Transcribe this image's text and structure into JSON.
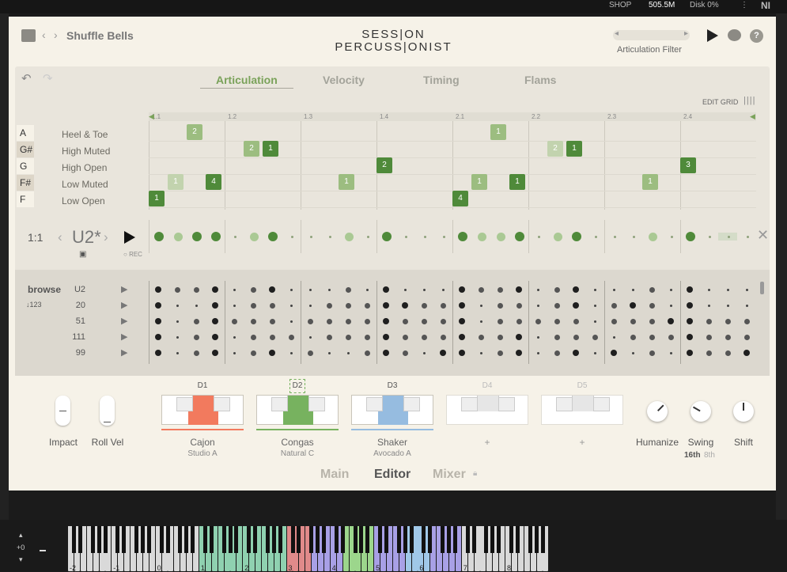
{
  "topbar": {
    "shop": "SHOP",
    "memory": "505.5M",
    "disk": "Disk 0%",
    "ni_logo": "NI"
  },
  "header": {
    "preset_name": "Shuffle Bells",
    "logo_line1": "SESS|ON",
    "logo_line2": "PERCUSS|ONIST",
    "articulation_filter": "Articulation Filter"
  },
  "tabs": [
    "Articulation",
    "Velocity",
    "Timing",
    "Flams"
  ],
  "active_tab": "Articulation",
  "edit_grid": "EDIT GRID",
  "ruler_ticks": [
    "1.1",
    "1.2",
    "1.3",
    "1.4",
    "2.1",
    "2.2",
    "2.3",
    "2.4"
  ],
  "rows": [
    {
      "note": "A",
      "label": "Heel & Toe"
    },
    {
      "note": "G#",
      "label": "High Muted"
    },
    {
      "note": "G",
      "label": "High Open"
    },
    {
      "note": "F#",
      "label": "Low Muted"
    },
    {
      "note": "F",
      "label": "Low Open"
    }
  ],
  "notes": [
    {
      "row": 0,
      "step": 2,
      "value": "2",
      "shade": 2
    },
    {
      "row": 0,
      "step": 18,
      "value": "1",
      "shade": 2
    },
    {
      "row": 1,
      "step": 5,
      "value": "2",
      "shade": 2
    },
    {
      "row": 1,
      "step": 6,
      "value": "1",
      "shade": 3
    },
    {
      "row": 1,
      "step": 21,
      "value": "2",
      "shade": 1
    },
    {
      "row": 1,
      "step": 22,
      "value": "1",
      "shade": 3
    },
    {
      "row": 2,
      "step": 12,
      "value": "2",
      "shade": 3
    },
    {
      "row": 2,
      "step": 28,
      "value": "3",
      "shade": 3
    },
    {
      "row": 3,
      "step": 1,
      "value": "1",
      "shade": 1
    },
    {
      "row": 3,
      "step": 3,
      "value": "4",
      "shade": 3
    },
    {
      "row": 3,
      "step": 10,
      "value": "1",
      "shade": 2
    },
    {
      "row": 3,
      "step": 17,
      "value": "1",
      "shade": 2
    },
    {
      "row": 3,
      "step": 19,
      "value": "1",
      "shade": 3
    },
    {
      "row": 3,
      "step": 26,
      "value": "1",
      "shade": 2
    },
    {
      "row": 4,
      "step": 0,
      "value": "1",
      "shade": 3
    },
    {
      "row": 4,
      "step": 16,
      "value": "4",
      "shade": 3
    }
  ],
  "pattern": {
    "ratio": "1:1",
    "name": "U2*",
    "rec": "REC"
  },
  "pattern_dots": [
    3,
    2,
    3,
    3,
    0,
    2,
    3,
    0,
    0,
    0,
    2,
    0,
    3,
    0,
    0,
    0,
    3,
    2,
    2,
    3,
    0,
    2,
    3,
    0,
    0,
    0,
    2,
    0,
    3,
    0,
    0,
    0
  ],
  "browse": {
    "title": "browse",
    "sort": "123",
    "rows": [
      {
        "name": "U2",
        "dots": [
          3,
          2,
          2,
          3,
          1,
          2,
          3,
          1,
          1,
          1,
          2,
          1,
          3,
          1,
          1,
          1,
          3,
          2,
          2,
          3,
          1,
          2,
          3,
          1,
          1,
          1,
          2,
          1,
          3,
          1,
          1,
          1
        ]
      },
      {
        "name": "20",
        "dots": [
          3,
          1,
          1,
          3,
          1,
          2,
          2,
          1,
          1,
          2,
          2,
          2,
          3,
          3,
          2,
          2,
          3,
          1,
          2,
          2,
          1,
          2,
          3,
          1,
          2,
          3,
          2,
          1,
          3,
          1,
          1,
          1
        ]
      },
      {
        "name": "51",
        "dots": [
          3,
          1,
          2,
          3,
          2,
          2,
          2,
          1,
          2,
          2,
          2,
          2,
          3,
          2,
          2,
          2,
          3,
          1,
          2,
          2,
          2,
          2,
          2,
          1,
          2,
          2,
          2,
          3,
          3,
          2,
          2,
          2
        ]
      },
      {
        "name": "111",
        "dots": [
          3,
          1,
          2,
          3,
          1,
          2,
          2,
          2,
          1,
          2,
          2,
          2,
          3,
          2,
          2,
          2,
          3,
          2,
          2,
          3,
          1,
          2,
          2,
          2,
          1,
          2,
          2,
          2,
          3,
          2,
          2,
          2
        ]
      },
      {
        "name": "99",
        "dots": [
          3,
          1,
          2,
          3,
          1,
          2,
          3,
          1,
          2,
          1,
          1,
          2,
          3,
          2,
          1,
          3,
          3,
          1,
          2,
          3,
          1,
          2,
          3,
          1,
          3,
          1,
          2,
          1,
          3,
          2,
          2,
          3
        ]
      }
    ]
  },
  "sliders": [
    {
      "label": "Impact"
    },
    {
      "label": "Roll Vel"
    }
  ],
  "drums": [
    {
      "slot": "D1",
      "name": "Cajon",
      "sub": "Studio A",
      "color": "#f27a5e",
      "active": true
    },
    {
      "slot": "D2",
      "name": "Congas",
      "sub": "Natural C",
      "color": "#77b25f",
      "active": true
    },
    {
      "slot": "D3",
      "name": "Shaker",
      "sub": "Avocado A",
      "color": "#96bce0",
      "active": true
    },
    {
      "slot": "D4",
      "name": "+",
      "sub": "",
      "color": "",
      "active": false
    },
    {
      "slot": "D5",
      "name": "+",
      "sub": "",
      "color": "",
      "active": false
    }
  ],
  "knobs": [
    {
      "label": "Humanize"
    },
    {
      "label": "Swing"
    },
    {
      "label": "Shift"
    }
  ],
  "swing_options": [
    "16th",
    "8th"
  ],
  "bottom_nav": [
    "Main",
    "Editor",
    "Mixer"
  ],
  "active_nav": "Editor",
  "piano": {
    "transpose": "+0",
    "octaves": [
      "-2",
      "-1",
      "0",
      "1",
      "2",
      "3",
      "4",
      "5",
      "6",
      "7",
      "8"
    ]
  }
}
